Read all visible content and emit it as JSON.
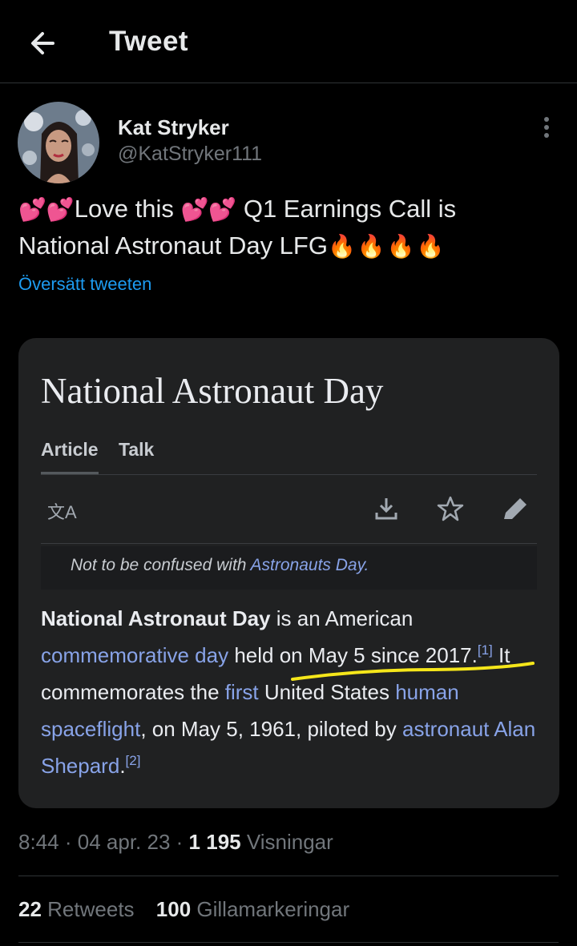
{
  "header": {
    "title": "Tweet"
  },
  "author": {
    "name": "Kat Stryker",
    "handle": "@KatStryker111"
  },
  "tweet": {
    "text_part1": "Love this",
    "text_part2": "Q1 Earnings Call is",
    "text_part3": "National Astronaut Day LFG",
    "heart_emoji": "💕",
    "fire_emoji": "🔥",
    "translate_label": "Översätt tweeten"
  },
  "embed": {
    "title": "National Astronaut Day",
    "tabs": [
      "Article",
      "Talk"
    ],
    "translate_glyph": "文A",
    "hatnote_prefix": "Not to be confused with",
    "hatnote_link": "Astronauts Day.",
    "para": {
      "bold_term": "National Astronaut Day",
      "t1": "is an American",
      "link1": "commemorative day",
      "t2": "held on May 5 since 2017.",
      "ref1": "[1]",
      "t3": "It commemorates the",
      "link2": "first",
      "t4": "United States",
      "link3": "human spaceflight",
      "t5": ", on May 5, 1961, piloted by",
      "link4": "astronaut",
      "link5": "Alan Shepard",
      "t6": ".",
      "ref2": "[2]"
    }
  },
  "meta": {
    "time": "8:44",
    "date": "04 apr. 23",
    "views_count": "1 195",
    "views_label": "Visningar",
    "separator": "·"
  },
  "stats": {
    "retweets_count": "22",
    "retweets_label": "Retweets",
    "likes_count": "100",
    "likes_label": "Gillamarkeringar"
  },
  "colors": {
    "background": "#000000",
    "accent": "#1d9bf0",
    "wiki_link": "#88a3e8",
    "highlight": "#f5e61a"
  }
}
